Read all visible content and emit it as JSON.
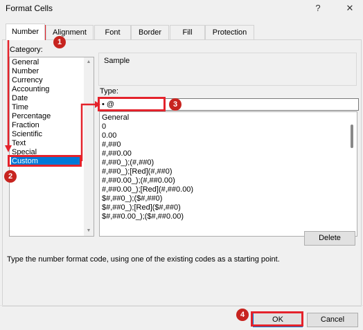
{
  "window": {
    "title": "Format Cells",
    "help_glyph": "?",
    "close_glyph": "✕"
  },
  "tabs": [
    {
      "label": "Number",
      "active": true
    },
    {
      "label": "Alignment"
    },
    {
      "label": "Font"
    },
    {
      "label": "Border"
    },
    {
      "label": "Fill"
    },
    {
      "label": "Protection"
    }
  ],
  "category": {
    "label": "Category:",
    "items": [
      "General",
      "Number",
      "Currency",
      "Accounting",
      "Date",
      "Time",
      "Percentage",
      "Fraction",
      "Scientific",
      "Text",
      "Special",
      "Custom"
    ],
    "selected": "Custom"
  },
  "sample": {
    "label": "Sample"
  },
  "type": {
    "label": "Type:",
    "value": "• @",
    "formats": [
      "General",
      "0",
      "0.00",
      "#,##0",
      "#,##0.00",
      "#,##0_);(#,##0)",
      "#,##0_);[Red](#,##0)",
      "#,##0.00_);(#,##0.00)",
      "#,##0.00_);[Red](#,##0.00)",
      "$#,##0_);($#,##0)",
      "$#,##0_);[Red]($#,##0)",
      "$#,##0.00_);($#,##0.00)"
    ]
  },
  "buttons": {
    "delete": "Delete",
    "ok": "OK",
    "cancel": "Cancel"
  },
  "description": "Type the number format code, using one of the existing codes as a starting point.",
  "steps": [
    "1",
    "2",
    "3",
    "4"
  ],
  "colors": {
    "highlight": "#e4222b",
    "step_badge": "#c7241f",
    "selection": "#0078d7"
  },
  "icons": {
    "scroll_up": "scroll-up-arrow-icon",
    "scroll_down": "scroll-down-arrow-icon"
  }
}
